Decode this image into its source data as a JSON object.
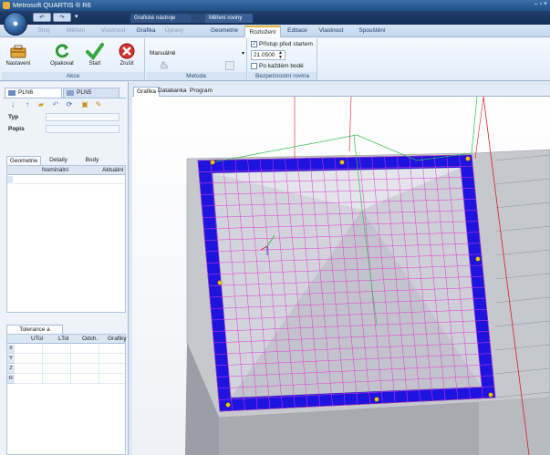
{
  "window": {
    "title": "Metrosoft QUARTIS ® R6",
    "controls": "– ▫ ×"
  },
  "quick_access": {
    "undo_label": "↶",
    "redo_label": "↷",
    "more_label": "▾"
  },
  "context_groups": {
    "graphic_tools": "Grafické nástroje",
    "measure_planes": "Měření roviny"
  },
  "ribbon_tabs": [
    {
      "label": "Stroj",
      "state": "dim"
    },
    {
      "label": "Měření",
      "state": "dim"
    },
    {
      "label": "Vlastnost",
      "state": "dim"
    },
    {
      "label": "Grafika",
      "state": "normal"
    },
    {
      "label": "Úpravy",
      "state": "dim"
    },
    {
      "label": "Geometrie",
      "state": "normal"
    },
    {
      "label": "Rozložení",
      "state": "active"
    },
    {
      "label": "Editace",
      "state": "normal"
    },
    {
      "label": "Vlastnost",
      "state": "normal"
    },
    {
      "label": "Spouštění",
      "state": "normal"
    }
  ],
  "groups": {
    "actions": {
      "label": "Akce",
      "settings": "Nastavení",
      "retry": "Opakovat",
      "start": "Start",
      "cancel": "Zrušit"
    },
    "method": {
      "label": "Metoda",
      "value": "Manuálně"
    },
    "safety_plane": {
      "label": "Bezpečnostní rovina",
      "approach_before_start": "Přístup před startem",
      "approach_checked": "✓",
      "value": "21.0500",
      "after_each_point": "Po každém bodě"
    }
  },
  "left_panel": {
    "tabs": [
      {
        "label": "PLN6"
      },
      {
        "label": "PLN5"
      }
    ],
    "type_label": "Typ",
    "desc_label": "Popis",
    "subtabs": [
      "Geometrie",
      "Detaily",
      "Body"
    ],
    "geometry_columns": [
      "Nominální",
      "Aktuální"
    ],
    "tolerance_tab": "Tolerance a odchylky",
    "tolerance_columns": [
      "UTol",
      "LTol",
      "Odch.",
      "Grafiky"
    ],
    "tolerance_rows": [
      "X",
      "Y",
      "Z",
      "R"
    ]
  },
  "graphics_tabs": [
    "Grafika",
    "Databanka",
    "Program"
  ],
  "colors": {
    "frame_blue": "#1d14e0",
    "mesh_magenta": "#e23ad8",
    "surface_gray": "#cbcbd3",
    "axis_red": "#d42020",
    "path_green": "#2fc24a",
    "point_yellow": "#f4c21a"
  }
}
